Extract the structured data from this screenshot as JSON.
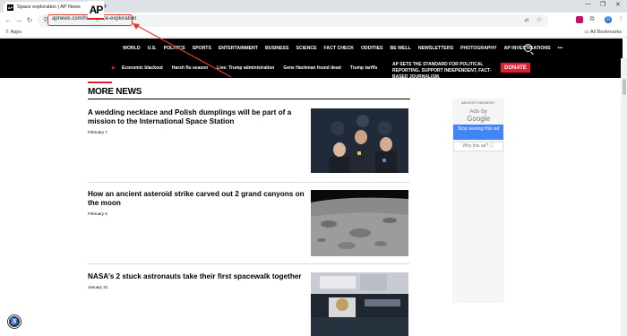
{
  "browser": {
    "tab_title": "Space exploration | AP News",
    "tab_favicon": "AP",
    "url": "apnews.com/hub/space-exploration",
    "bookmarks": {
      "apps": "Apps",
      "all": "All Bookmarks"
    },
    "profile_initial": "G"
  },
  "header": {
    "logo": "AP",
    "nav": [
      "WORLD",
      "U.S.",
      "POLITICS",
      "SPORTS",
      "ENTERTAINMENT",
      "BUSINESS",
      "SCIENCE",
      "FACT CHECK",
      "ODDITIES",
      "BE WELL",
      "NEWSLETTERS",
      "PHOTOGRAPHY",
      "AP INVESTIGATIONS",
      "•••"
    ],
    "trending": [
      "Economic blackout",
      "Harsh flu season",
      "Live: Trump administration",
      "Gene Hackman found dead",
      "Trump tariffs"
    ],
    "tagline": "AP SETS THE STANDARD FOR POLITICAL REPORTING. SUPPORT INDEPENDENT, FACT-BASED JOURNALISM.",
    "donate": "DONATE"
  },
  "main": {
    "section_title": "MORE NEWS",
    "articles": [
      {
        "title": "A wedding necklace and Polish dumplings will be part of a mission to the International Space Station",
        "date": "February 7"
      },
      {
        "title": "How an ancient asteroid strike carved out 2 grand canyons on the moon",
        "date": "February 5"
      },
      {
        "title": "NASA’s 2 stuck astronauts take their first spacewalk together",
        "date": "January 31"
      }
    ]
  },
  "sidebar": {
    "ad_label": "ADVERTISEMENT",
    "ads_by": "Ads by",
    "google": "Google",
    "stop_ad": "Stop seeing this ad",
    "why_ad": "Why this ad? ⓘ"
  },
  "colors": {
    "accent": "#e21d2e",
    "header_bg": "#000000",
    "ad_button": "#4285f4"
  }
}
